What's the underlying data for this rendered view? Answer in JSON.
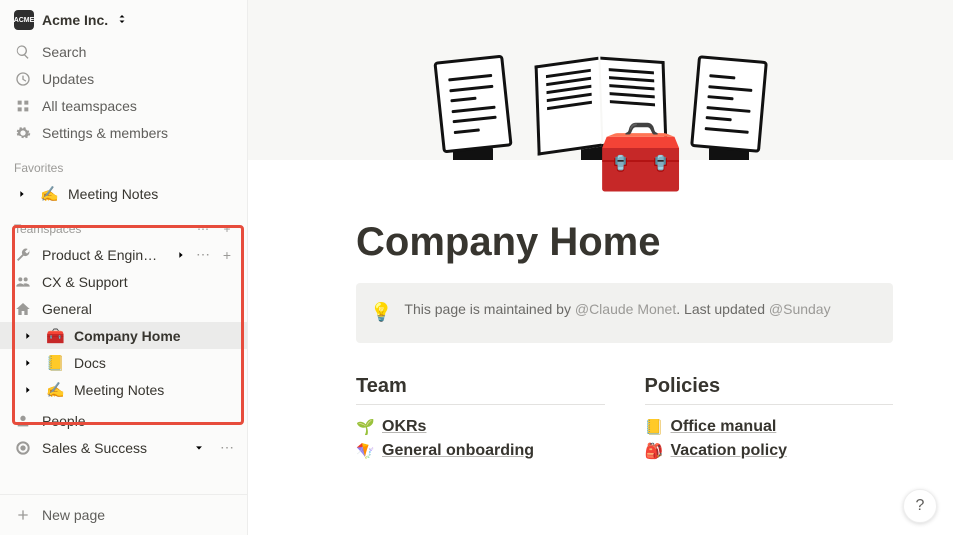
{
  "workspace": {
    "name": "Acme Inc.",
    "badge": "ACME"
  },
  "nav": {
    "search": "Search",
    "updates": "Updates",
    "all_teamspaces": "All teamspaces",
    "settings": "Settings & members"
  },
  "favorites": {
    "header": "Favorites",
    "items": [
      {
        "emoji": "✍️",
        "label": "Meeting Notes"
      }
    ]
  },
  "teamspaces": {
    "header": "Teamspaces",
    "items": [
      {
        "icon": "wrench",
        "label": "Product & Engin…",
        "expanded": true,
        "has_actions": true
      },
      {
        "icon": "group",
        "label": "CX & Support"
      },
      {
        "icon": "home",
        "label": "General"
      }
    ],
    "subpages": [
      {
        "emoji": "🧰",
        "label": "Company Home",
        "selected": true
      },
      {
        "emoji": "📒",
        "label": "Docs"
      },
      {
        "emoji": "✍️",
        "label": "Meeting Notes"
      }
    ]
  },
  "private": {
    "people": "People",
    "sales": "Sales & Success"
  },
  "new_page": "New page",
  "page": {
    "icon": "🧰",
    "title": "Company Home",
    "callout": {
      "bulb": "💡",
      "prefix": "This page is maintained by ",
      "mention1": "@Claude Monet",
      "mid": ". Last updated ",
      "mention2": "@Sunday"
    },
    "columns": [
      {
        "heading": "Team",
        "links": [
          {
            "emoji": "🌱",
            "label": "OKRs"
          },
          {
            "emoji": "🪁",
            "label": "General onboarding"
          }
        ]
      },
      {
        "heading": "Policies",
        "links": [
          {
            "emoji": "📒",
            "label": "Office manual"
          },
          {
            "emoji": "🎒",
            "label": "Vacation policy"
          }
        ]
      }
    ]
  },
  "help": "?"
}
